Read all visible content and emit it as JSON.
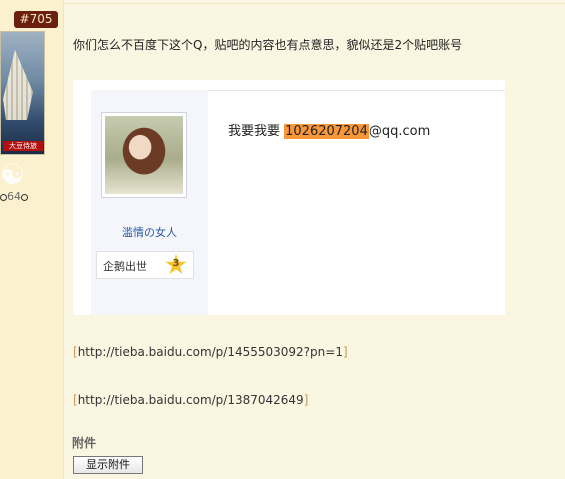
{
  "floor": {
    "label": "#705"
  },
  "author": {
    "avatar_tag": "大豆侍旅",
    "stat": "64"
  },
  "post": {
    "text": "你们怎么不百度下这个Q，贴吧的内容也有点意思，貌似还是2个贴吧账号"
  },
  "quote": {
    "user_name": "滥情の女人",
    "level_title": "企鹅出世",
    "level_num": "3",
    "text_prefix": "我要我要 ",
    "highlight": "1026207204",
    "text_suffix": "@qq.com"
  },
  "links": [
    {
      "open": "[",
      "url": "http://tieba.baidu.com/p/1455503092?pn=1",
      "close": "]"
    },
    {
      "open": "[",
      "url": "http://tieba.baidu.com/p/1387042649",
      "close": "]"
    }
  ],
  "attachment": {
    "title": "附件",
    "button_label": "显示附件"
  },
  "colors": {
    "page_bg": "#fbf6e2",
    "floor_badge": "#6b1f0c",
    "highlight": "#f7973a",
    "username": "#2a57a3"
  }
}
